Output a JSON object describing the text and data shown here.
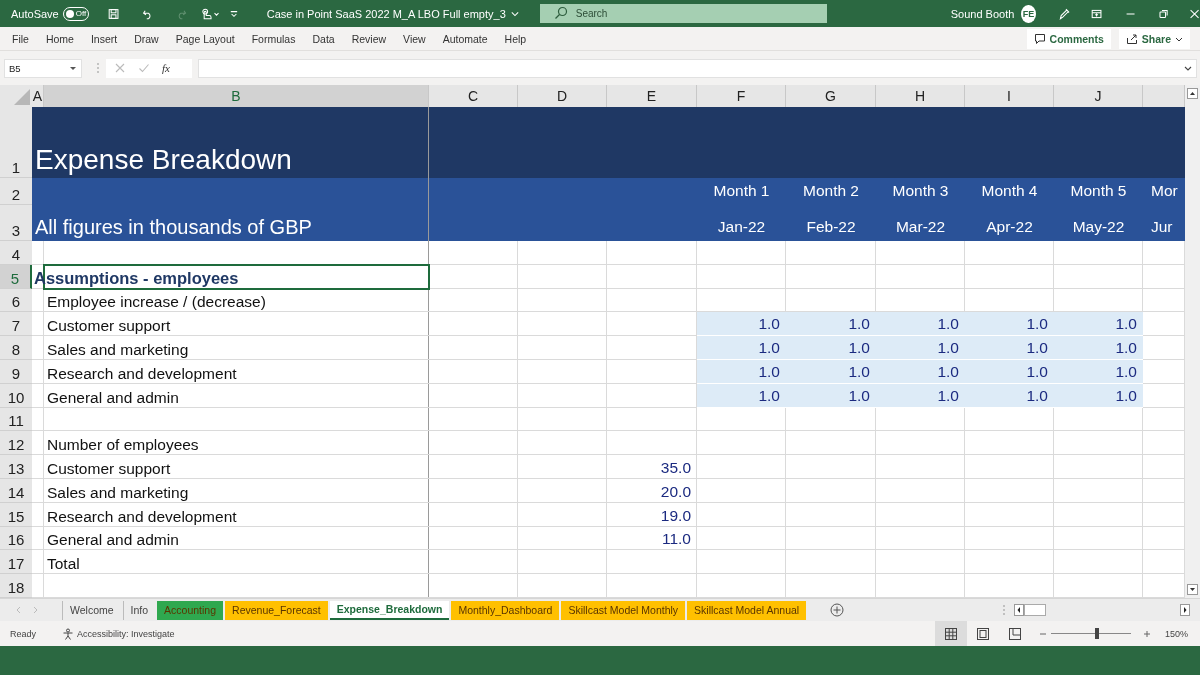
{
  "title_bar": {
    "autosave": {
      "label": "AutoSave",
      "state": "Off",
      "on": false
    },
    "document_title": "Case in Point SaaS 2022 M_A LBO Full empty_3",
    "search": {
      "placeholder": "Search"
    },
    "user_name": "Sound Booth",
    "avatar_initials": "FE"
  },
  "ribbon_tabs": [
    "File",
    "Home",
    "Insert",
    "Draw",
    "Page Layout",
    "Formulas",
    "Data",
    "Review",
    "View",
    "Automate",
    "Help"
  ],
  "comments_button": "Comments",
  "share_button": "Share",
  "name_box": "B5",
  "formula_bar": {
    "function_label": "fx"
  },
  "columns": [
    "A",
    "B",
    "C",
    "D",
    "E",
    "F",
    "G",
    "H",
    "I",
    "J"
  ],
  "rows": [
    {
      "number": "1",
      "kind": "title",
      "label": "Expense Breakdown",
      "selected": false
    },
    {
      "number": "2",
      "kind": "band",
      "selected": false,
      "cells": {
        "F": "Month 1",
        "G": "Month 2",
        "H": "Month 3",
        "I": "Month 4",
        "J": "Month 5",
        "K": "Mor"
      }
    },
    {
      "number": "3",
      "kind": "band",
      "label": "All figures in thousands of GBP",
      "selected": false,
      "cells": {
        "F": "Jan-22",
        "G": "Feb-22",
        "H": "Mar-22",
        "I": "Apr-22",
        "J": "May-22",
        "K": "Jur"
      }
    },
    {
      "number": "4",
      "kind": "blank",
      "selected": false
    },
    {
      "number": "5",
      "kind": "section",
      "label": "Assumptions - employees",
      "selected": true
    },
    {
      "number": "6",
      "kind": "item",
      "label": "Employee increase / (decrease)",
      "selected": false
    },
    {
      "number": "7",
      "kind": "input",
      "label": "Customer support",
      "selected": false,
      "cells": {
        "F": "1.0",
        "G": "1.0",
        "H": "1.0",
        "I": "1.0",
        "J": "1.0"
      }
    },
    {
      "number": "8",
      "kind": "input",
      "label": "Sales and marketing",
      "selected": false,
      "cells": {
        "F": "1.0",
        "G": "1.0",
        "H": "1.0",
        "I": "1.0",
        "J": "1.0"
      }
    },
    {
      "number": "9",
      "kind": "input",
      "label": "Research and development",
      "selected": false,
      "cells": {
        "F": "1.0",
        "G": "1.0",
        "H": "1.0",
        "I": "1.0",
        "J": "1.0"
      }
    },
    {
      "number": "10",
      "kind": "input",
      "label": "General and admin",
      "selected": false,
      "cells": {
        "F": "1.0",
        "G": "1.0",
        "H": "1.0",
        "I": "1.0",
        "J": "1.0"
      }
    },
    {
      "number": "11",
      "kind": "blank",
      "selected": false
    },
    {
      "number": "12",
      "kind": "item",
      "label": "Number of employees",
      "selected": false
    },
    {
      "number": "13",
      "kind": "count",
      "label": "Customer support",
      "selected": false,
      "cells": {
        "E": "35.0"
      }
    },
    {
      "number": "14",
      "kind": "count",
      "label": "Sales and marketing",
      "selected": false,
      "cells": {
        "E": "20.0"
      }
    },
    {
      "number": "15",
      "kind": "count",
      "label": "Research and development",
      "selected": false,
      "cells": {
        "E": "19.0"
      }
    },
    {
      "number": "16",
      "kind": "count",
      "label": "General and admin",
      "selected": false,
      "cells": {
        "E": "11.0"
      }
    },
    {
      "number": "17",
      "kind": "item",
      "label": "Total",
      "selected": false
    },
    {
      "number": "18",
      "kind": "blank",
      "selected": false
    }
  ],
  "sheet_tabs": [
    {
      "label": "Welcome",
      "selected": false
    },
    {
      "label": "Info",
      "selected": false
    },
    {
      "label": "Accounting",
      "selected": false,
      "color": "#2fa84f"
    },
    {
      "label": "Revenue_Forecast",
      "selected": false,
      "color": "#ffc000"
    },
    {
      "label": "Expense_Breakdown",
      "selected": true
    },
    {
      "label": "Monthly_Dashboard",
      "selected": false,
      "color": "#ffc000"
    },
    {
      "label": "Skillcast Model Monthly",
      "selected": false,
      "color": "#ffc000"
    },
    {
      "label": "Skillcast Model Annual",
      "selected": false,
      "color": "#ffc000"
    }
  ],
  "status_bar": {
    "status": "Ready",
    "accessibility": "Accessibility: Investigate",
    "views": [
      {
        "kind": "normal",
        "selected": true
      },
      {
        "kind": "page-layout",
        "selected": false
      },
      {
        "kind": "page-break",
        "selected": false
      }
    ],
    "zoom": {
      "level": 0.57,
      "label": "150%"
    }
  }
}
